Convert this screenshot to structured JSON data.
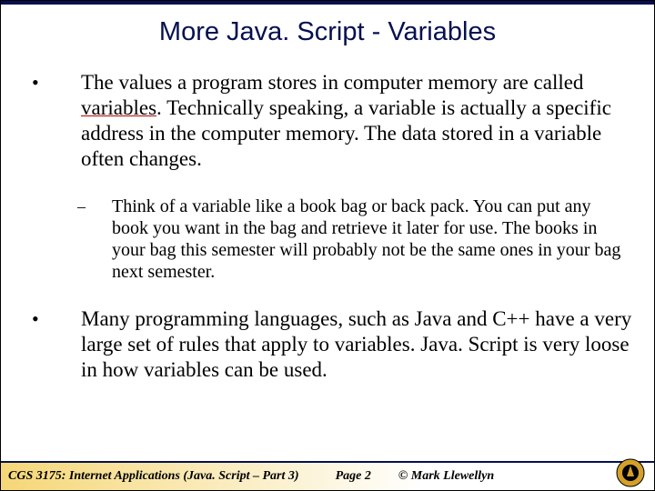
{
  "title": "More Java. Script - Variables",
  "bullets": {
    "b1_pre": "The values a program stores in computer memory are called ",
    "b1_underlined": "variables",
    "b1_post": ".   Technically speaking, a variable is actually a specific address in the computer memory.  The data stored in a variable often changes.",
    "b2": "Think of a variable like a book bag or back pack.  You can put any book you want in the bag and retrieve it later for use.  The books in your bag this semester will probably not be the same ones in your bag next semester.",
    "b3": "Many programming languages, such as Java and C++ have a very large set of rules that apply to variables.  Java. Script is very loose in how variables can be used."
  },
  "footer": {
    "course": "CGS 3175: Internet Applications (Java. Script – Part 3)",
    "page": "Page 2",
    "copyright": "© Mark Llewellyn"
  }
}
